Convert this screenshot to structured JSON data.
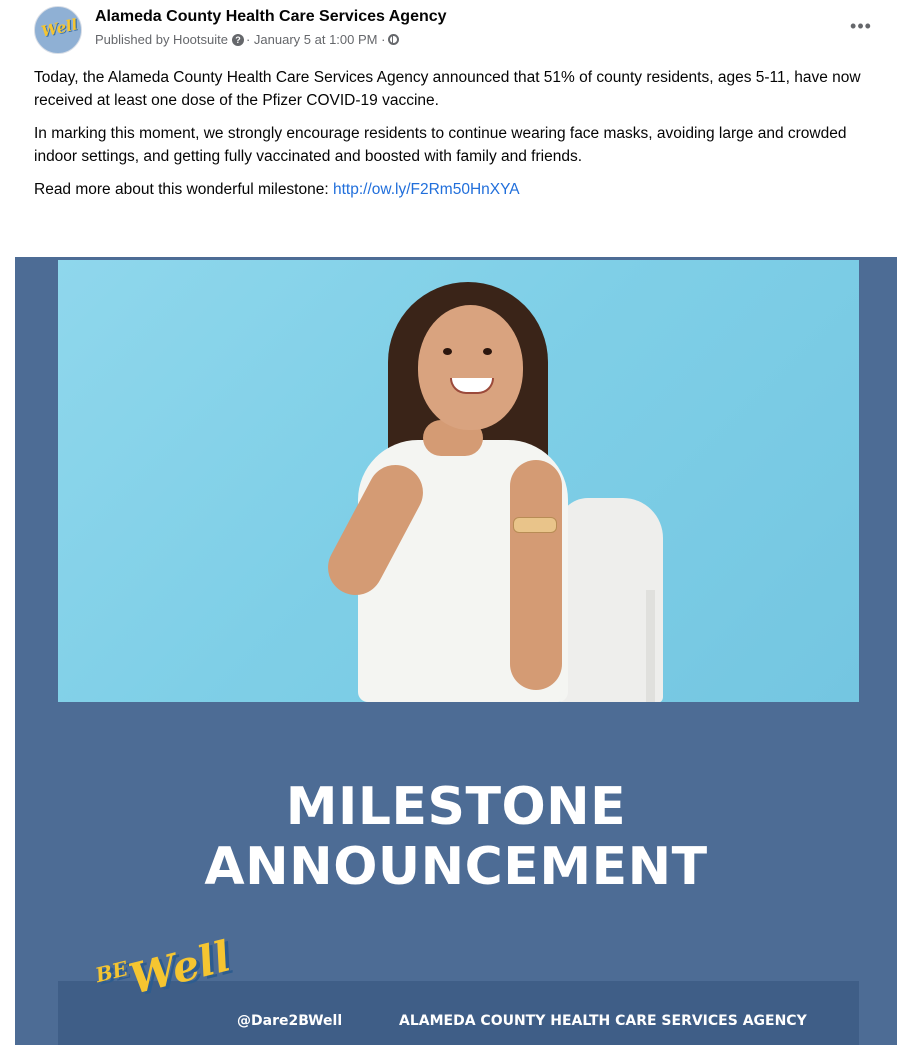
{
  "post": {
    "page_name": "Alameda County Health Care Services Agency",
    "publisher_prefix": "Published by Hootsuite",
    "date_text": "· January 5 at 1:00 PM ·",
    "avatar_text": "Well",
    "more_label": "•••",
    "paragraphs": [
      "Today, the Alameda County Health Care Services Agency announced that 51% of county residents, ages 5-11, have now received at least one dose of the Pfizer COVID-19 vaccine.",
      "In marking this moment, we strongly encourage residents to continue wearing face masks, avoiding large and crowded indoor settings, and getting fully vaccinated and boosted with family and friends."
    ],
    "read_more_text": "Read more about this wonderful milestone:",
    "link_text": "http://ow.ly/F2Rm50HnXYA"
  },
  "graphic": {
    "headline_line1": "MILESTONE",
    "headline_line2": "ANNOUNCEMENT",
    "brand_small": "BE",
    "brand_large": "Well",
    "handle": "@Dare2BWell",
    "agency": "ALAMEDA COUNTY  HEALTH CARE SERVICES AGENCY",
    "colors": {
      "panel": "#4d6c95",
      "footer": "#3f5e87",
      "photo_bg": "#7fcfe7",
      "brand_yellow": "#f5c531"
    }
  },
  "icons": {
    "question": "?",
    "globe": "globe-icon",
    "more": "more-options-icon"
  }
}
